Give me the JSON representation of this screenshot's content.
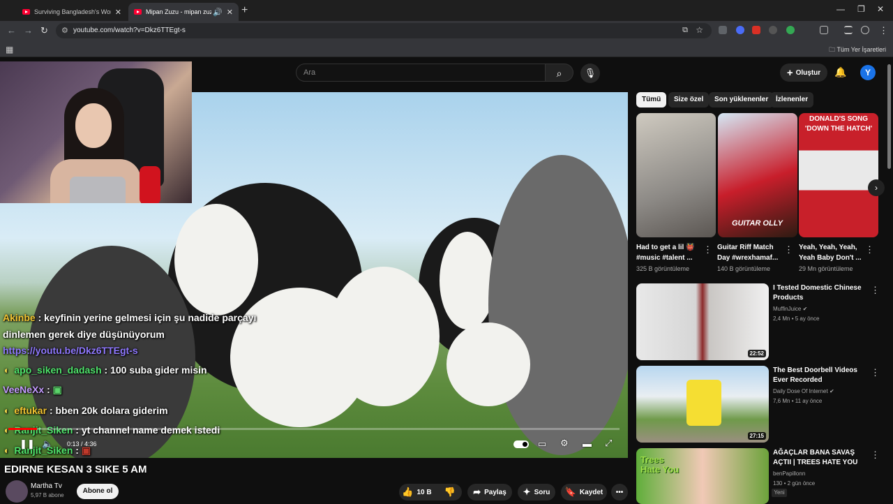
{
  "browser": {
    "tabs": [
      {
        "title": "Surviving Bangladesh's Worst S"
      },
      {
        "title": "Mipan Zuzu - mipan zuzu"
      }
    ],
    "url": "youtube.com/watch?v=Dkz6TTEgt-s",
    "all_bookmarks": "Tüm Yer İşaretleri"
  },
  "yt": {
    "search_placeholder": "Ara",
    "create_label": "Oluştur",
    "avatar_letter": "Y"
  },
  "chat": [
    {
      "name": "Akinbe",
      "text": ": keyfinin yerine gelmesi için şu nadide parçayı"
    },
    {
      "text": "dinlemen gerek diye düşünüyorum"
    },
    {
      "text": "https://youtu.be/Dkz6TTEgt-s"
    },
    {
      "name": "apo_siken_dadash",
      "text": ": 100 suba gider misin"
    },
    {
      "name": "VeeNeXx",
      "text": ":"
    },
    {
      "name": "eftukar",
      "text": ": bben 20k dolara giderim"
    },
    {
      "name": "Ranjit_Siken",
      "text": ": yt channel name demek istedi"
    },
    {
      "name": "Ranjit_Siken",
      "text": ":"
    }
  ],
  "player": {
    "time": "0:13 / 4:36",
    "progress": 0.047
  },
  "ticker": "EDIRNE KESAN 3 SIKE 5 AM",
  "channel": {
    "name": "Martha Tv",
    "subs": "5,97 B abone",
    "subscribe_label": "Abone ol"
  },
  "actions": {
    "likes": "10 B",
    "share": "Paylaş",
    "ask": "Soru",
    "save": "Kaydet"
  },
  "chips": [
    "Tümü",
    "Size özel",
    "Son yüklenenler",
    "İzlenenler"
  ],
  "shorts": [
    {
      "title": "Had to get a lil 👹 #music #talent ...",
      "views": "325 B görüntüleme"
    },
    {
      "title": "Guitar Riff Match Day #wrexhamaf...",
      "views": "140 B görüntüleme",
      "overlay": "GUITAR OLLY"
    },
    {
      "title": "Yeah, Yeah, Yeah, Yeah Baby Don't ...",
      "views": "29 Mn görüntüleme",
      "overlay": "DONALD'S SONG 'DOWN THE HATCH'"
    }
  ],
  "videos": [
    {
      "title": "I Tested Domestic Chinese Products",
      "channel": "MuffinJuice",
      "views": "2,4 Mn",
      "ago": "5 ay önce",
      "duration": "22:52"
    },
    {
      "title": "The Best Doorbell Videos Ever Recorded",
      "channel": "Daily Dose Of Internet",
      "views": "7,6 Mn",
      "ago": "11 ay önce",
      "duration": "27:15"
    },
    {
      "title": "AĞAÇLAR BANA SAVAŞ AÇTII | TREES HATE YOU",
      "channel": "benPapillonn",
      "views": "130",
      "ago": "2 gün önce",
      "badge": "Yeni",
      "overlay": "Trees Hate You"
    }
  ]
}
